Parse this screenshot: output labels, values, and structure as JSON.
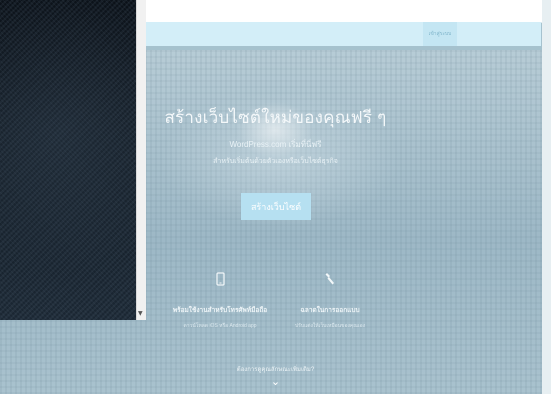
{
  "browser": {
    "menu_dots": "⋮"
  },
  "nav": {
    "left_text": "",
    "signin_label": "เข้าสู่ระบบ"
  },
  "hero": {
    "headline": "สร้างเว็บไซต์ใหม่ของคุณฟรี ๆ",
    "subhead": "WordPress.com เริ่มที่นี่ฟรี",
    "subhead2": "สำหรับเริ่มต้นด้วยตัวเองหรือเว็บไซต์ธุรกิจ",
    "cta_label": "สร้างเว็บไซต์"
  },
  "features": [
    {
      "icon": "mobile-icon",
      "title": "พร้อมใช้งานสำหรับโทรศัพท์มือถือ",
      "subtitle": "ดาวน์โหลด iOS หรือ Android app"
    },
    {
      "icon": "wrench-icon",
      "title": "ฉลาดในการออกแบบ",
      "subtitle": "ปรับแต่งให้เว็บเหมือนของคุณเอง"
    }
  ],
  "more": {
    "label": "ต้องการดูคุณลักษณะเพิ่มเติม?",
    "chevron": "⌄"
  }
}
